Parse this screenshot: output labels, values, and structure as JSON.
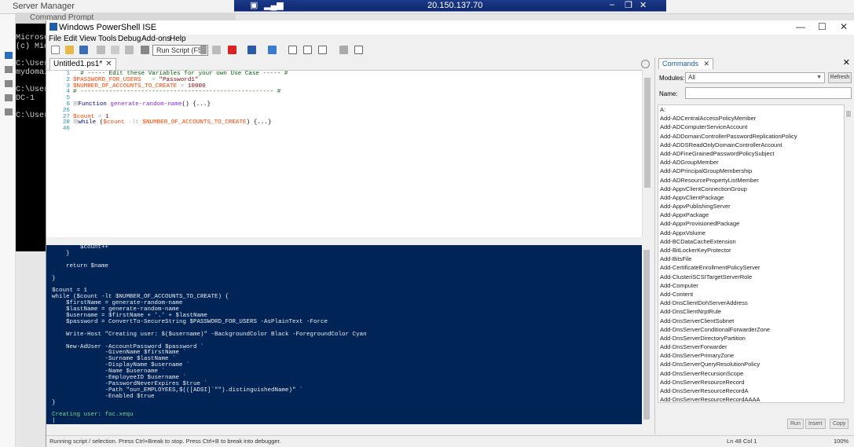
{
  "remote_bar": {
    "ip": "20.150.137.70",
    "minimize": "–",
    "restore": "❐",
    "close": "✕"
  },
  "server_manager": {
    "title": "Server Manager"
  },
  "cmd_prompt": {
    "title": "Command Prompt",
    "lines": [
      "",
      "Microso",
      "(c) Mic",
      "",
      "C:\\User",
      "mydomai",
      "",
      "C:\\User",
      "DC-1",
      "",
      "C:\\User"
    ]
  },
  "ise": {
    "title": "Windows PowerShell ISE",
    "window_controls": {
      "minimize": "—",
      "maximize": "☐",
      "close": "✕"
    },
    "menu": [
      "File",
      "Edit",
      "View",
      "Tools",
      "Debug",
      "Add-ons",
      "Help"
    ],
    "tooltip": "Run Script (F5)",
    "script_tab": {
      "label": "Untitled1.ps1*",
      "close": "✕"
    },
    "line_numbers": [
      "1",
      "2",
      "3",
      "4",
      "5",
      "6",
      "26",
      "27",
      "28",
      "46"
    ],
    "console_last": "Creating user: foc.xequ",
    "commands_pane": {
      "tab_label": "Commands",
      "close": "✕",
      "pane_close": "✕",
      "modules_label": "Modules:",
      "modules_value": "All",
      "refresh": "Refresh",
      "name_label": "Name:",
      "items": [
        "A:",
        "Add-ADCentralAccessPolicyMember",
        "Add-ADComputerServiceAccount",
        "Add-ADDomainControllerPasswordReplicationPolicy",
        "Add-ADDSReadOnlyDomainControllerAccount",
        "Add-ADFineGrainedPasswordPolicySubject",
        "Add-ADGroupMember",
        "Add-ADPrincipalGroupMembership",
        "Add-ADResourcePropertyListMember",
        "Add-AppvClientConnectionGroup",
        "Add-AppvClientPackage",
        "Add-AppvPublishingServer",
        "Add-AppxPackage",
        "Add-AppxProvisionedPackage",
        "Add-AppxVolume",
        "Add-BCDataCacheExtension",
        "Add-BitLockerKeyProtector",
        "Add-BitsFile",
        "Add-CertificateEnrollmentPolicyServer",
        "Add-ClusteriSCSITargetServerRole",
        "Add-Computer",
        "Add-Content",
        "Add-DnsClientDohServerAddress",
        "Add-DnsClientNrptRule",
        "Add-DnsServerClientSubnet",
        "Add-DnsServerConditionalForwarderZone",
        "Add-DnsServerDirectoryPartition",
        "Add-DnsServerForwarder",
        "Add-DnsServerPrimaryZone",
        "Add-DnsServerQueryResolutionPolicy",
        "Add-DnsServerRecursionScope",
        "Add-DnsServerResourceRecord",
        "Add-DnsServerResourceRecordA",
        "Add-DnsServerResourceRecordAAAA"
      ],
      "buttons": [
        "Run",
        "Insert",
        "Copy"
      ]
    },
    "status": {
      "message": "Running script / selection.  Press Ctrl+Break to stop.  Press Ctrl+B to break into debugger.",
      "position": "Ln 48  Col 1",
      "zoom": "100%"
    }
  }
}
